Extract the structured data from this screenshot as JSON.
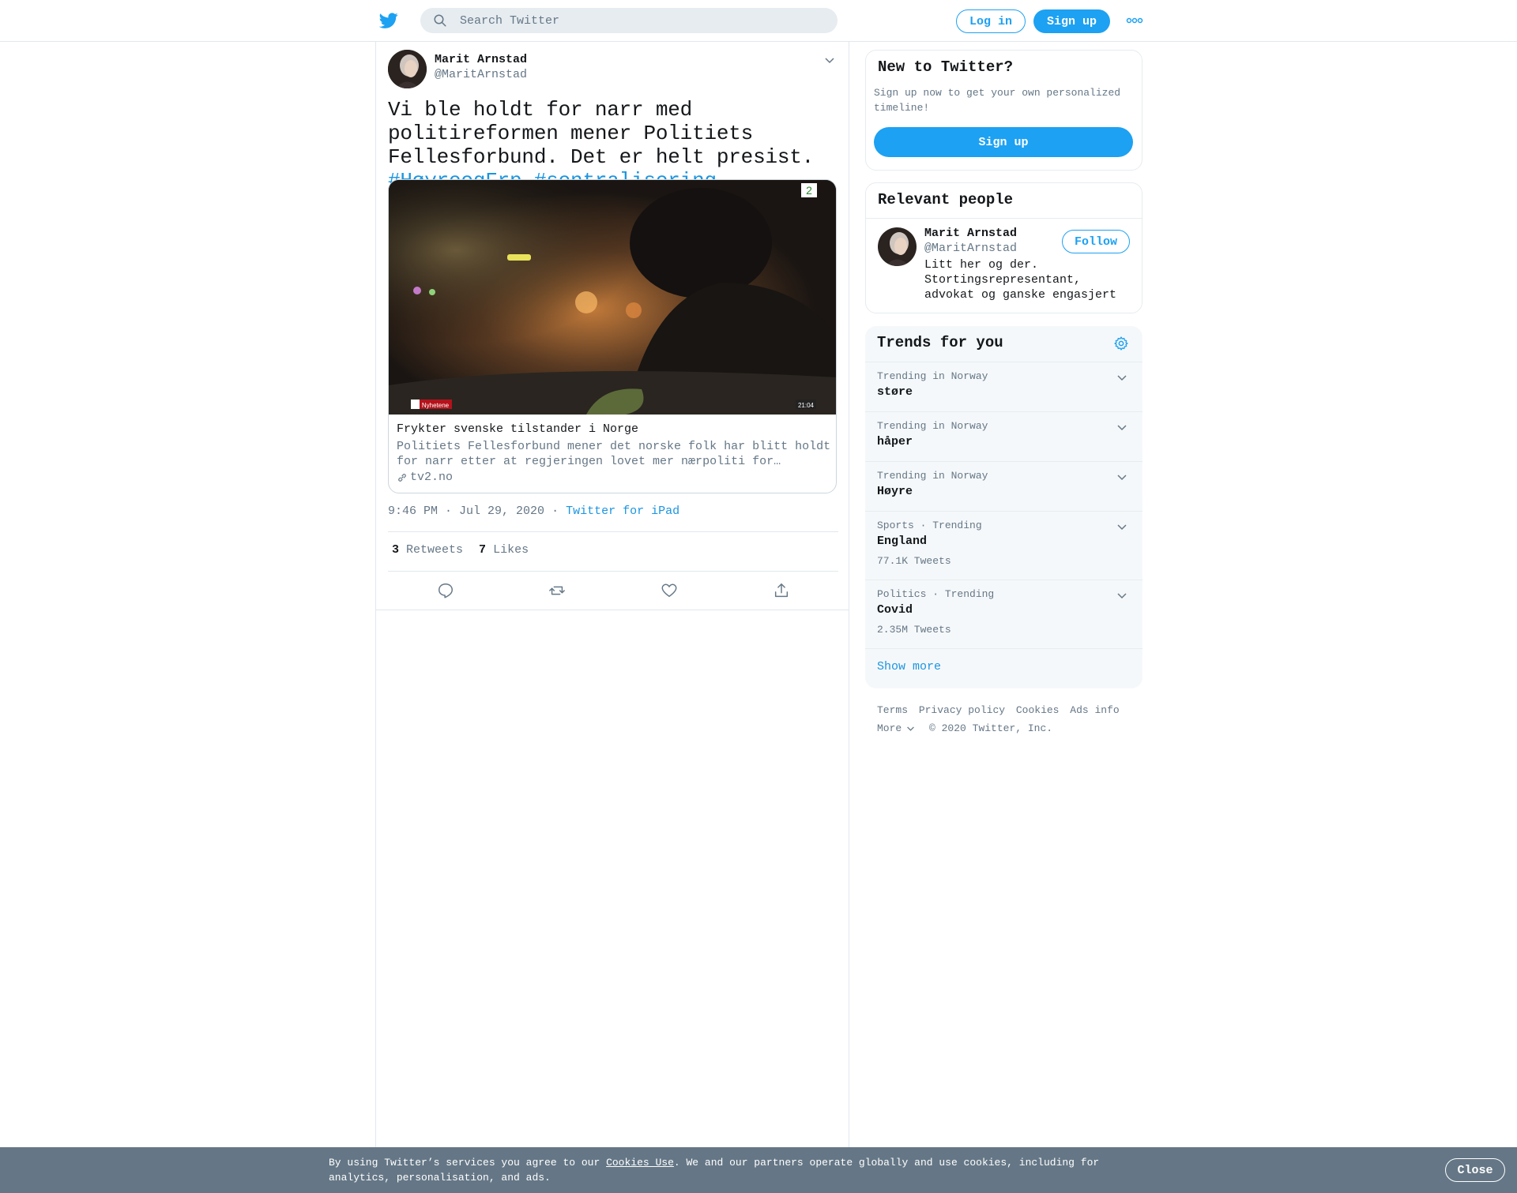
{
  "header": {
    "search_placeholder": "Search Twitter",
    "login_label": "Log in",
    "signup_label": "Sign up"
  },
  "tweet": {
    "author_name": "Marit Arnstad",
    "author_handle": "@MaritArnstad",
    "text": "Vi ble holdt for narr med politireformen mener Politiets Fellesforbund. Det er helt presist.",
    "hashtags": [
      "#HøyreogFrp",
      "#sentralisering"
    ],
    "card": {
      "title": "Frykter svenske tilstander i Norge",
      "description": "Politiets Fellesforbund mener det norske folk har blitt holdt for narr etter at regjeringen lovet mer nærpoliti for…",
      "domain": "tv2.no",
      "overlay_label": "Nyhetene",
      "overlay_time": "21:04"
    },
    "timestamp": "9:46 PM · Jul 29, 2020",
    "source_separator": "·",
    "source": "Twitter for iPad",
    "retweets_count": "3",
    "retweets_label": "Retweets",
    "likes_count": "7",
    "likes_label": "Likes"
  },
  "sidebar": {
    "new_to_twitter": {
      "title": "New to Twitter?",
      "description": "Sign up now to get your own personalized timeline!",
      "button_label": "Sign up"
    },
    "relevant_people": {
      "title": "Relevant people",
      "name": "Marit Arnstad",
      "handle": "@MaritArnstad",
      "bio": "Litt her og der. Stortingsrepresentant, advokat og ganske engasjert",
      "follow_label": "Follow"
    },
    "trends": {
      "title": "Trends for you",
      "items": [
        {
          "context": "Trending in Norway",
          "name": "støre",
          "count": ""
        },
        {
          "context": "Trending in Norway",
          "name": "håper",
          "count": ""
        },
        {
          "context": "Trending in Norway",
          "name": "Høyre",
          "count": ""
        },
        {
          "context": "Sports · Trending",
          "name": "England",
          "count": "77.1K Tweets"
        },
        {
          "context": "Politics · Trending",
          "name": "Covid",
          "count": "2.35M Tweets"
        }
      ],
      "show_more": "Show more"
    },
    "footer": {
      "links": [
        "Terms",
        "Privacy policy",
        "Cookies",
        "Ads info"
      ],
      "more": "More",
      "copyright": "© 2020 Twitter, Inc."
    }
  },
  "cookie_banner": {
    "text_before": "By using Twitter’s services you agree to our ",
    "link": "Cookies Use",
    "text_after": ". We and our partners operate globally and use cookies, including for analytics, personalisation, and ads.",
    "close_label": "Close"
  },
  "colors": {
    "brand_blue": "#1da1f2",
    "link_blue": "#1b95e0",
    "secondary_text": "#657786",
    "cookie_bg": "#657786"
  }
}
